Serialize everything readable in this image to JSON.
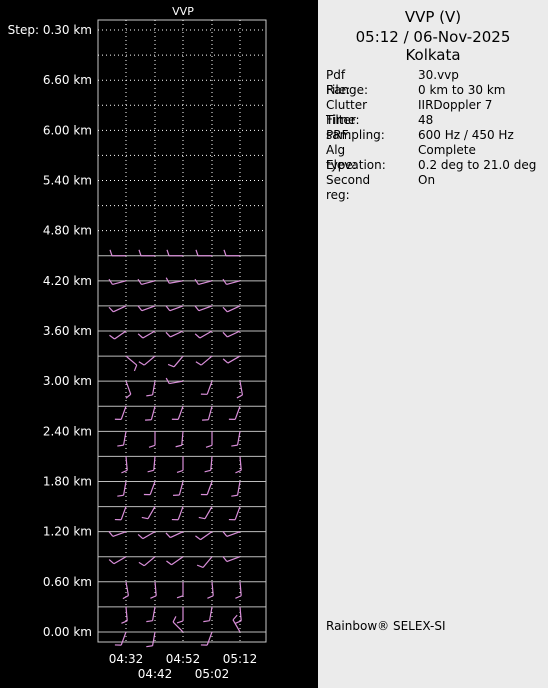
{
  "header": {
    "line1": "VVP (V)",
    "line2": "05:12 / 06-Nov-2025",
    "line3": "Kolkata"
  },
  "info": [
    {
      "label": "Pdf File:",
      "value": "30.vvp"
    },
    {
      "label": "Range:",
      "value": "0 km to 30 km"
    },
    {
      "label": "Clutter Filter:",
      "value": "IIRDoppler 7"
    },
    {
      "label": "Time sampling:",
      "value": "48"
    },
    {
      "label": "PRF:",
      "value": "600 Hz / 450 Hz"
    },
    {
      "label": "Alg type:",
      "value": "Complete"
    },
    {
      "label": "Elevation:",
      "value": "0.2 deg to 21.0 deg"
    },
    {
      "label": "Second reg:",
      "value": "On"
    }
  ],
  "vendor": "Rainbow® SELEX-SI",
  "chart_data": {
    "type": "wind-barb-profile",
    "title": "VVP",
    "y_tick_labels": [
      "Step: 0.30 km",
      "6.60 km",
      "6.00 km",
      "5.40 km",
      "4.80 km",
      "4.20 km",
      "3.60 km",
      "3.00 km",
      "2.40 km",
      "1.80 km",
      "1.20 km",
      "0.60 km",
      "0.00 km"
    ],
    "y_ticks_km": [
      7.2,
      6.6,
      6.0,
      5.4,
      4.8,
      4.2,
      3.6,
      3.0,
      2.4,
      1.8,
      1.2,
      0.6,
      0.0
    ],
    "ylim_km": [
      -0.12,
      7.32
    ],
    "height_step_km": 0.3,
    "x_tick_labels_top": [
      "04:32",
      "04:52",
      "05:12"
    ],
    "x_tick_labels_bottom": [
      "04:42",
      "05:02"
    ],
    "times": [
      "04:32",
      "04:42",
      "04:52",
      "05:02",
      "05:12"
    ],
    "heights_km": [
      0.0,
      0.3,
      0.6,
      0.9,
      1.2,
      1.5,
      1.8,
      2.1,
      2.4,
      2.7,
      3.0,
      3.3,
      3.6,
      3.9,
      4.2,
      4.5
    ],
    "barb_color": "#d98ed9",
    "grid": true,
    "barbs": [
      {
        "height_km": 0.0,
        "dir_deg": [
          200,
          190,
          315,
          200,
          330
        ]
      },
      {
        "height_km": 0.3,
        "dir_deg": [
          175,
          190,
          180,
          190,
          175
        ]
      },
      {
        "height_km": 0.6,
        "dir_deg": [
          170,
          175,
          180,
          175,
          175
        ]
      },
      {
        "height_km": 0.9,
        "dir_deg": [
          240,
          230,
          235,
          220,
          250
        ]
      },
      {
        "height_km": 1.2,
        "dir_deg": [
          250,
          240,
          245,
          235,
          250
        ]
      },
      {
        "height_km": 1.5,
        "dir_deg": [
          200,
          210,
          200,
          210,
          200
        ]
      },
      {
        "height_km": 1.8,
        "dir_deg": [
          190,
          200,
          195,
          200,
          190
        ]
      },
      {
        "height_km": 2.1,
        "dir_deg": [
          175,
          185,
          180,
          185,
          175
        ]
      },
      {
        "height_km": 2.4,
        "dir_deg": [
          190,
          180,
          185,
          180,
          190
        ]
      },
      {
        "height_km": 2.7,
        "dir_deg": [
          200,
          195,
          200,
          195,
          200
        ]
      },
      {
        "height_km": 3.0,
        "dir_deg": [
          160,
          190,
          260,
          200,
          170
        ]
      },
      {
        "height_km": 3.3,
        "dir_deg": [
          130,
          230,
          220,
          230,
          240
        ]
      },
      {
        "height_km": 3.6,
        "dir_deg": [
          235,
          240,
          245,
          240,
          245
        ]
      },
      {
        "height_km": 3.9,
        "dir_deg": [
          245,
          250,
          250,
          250,
          245
        ]
      },
      {
        "height_km": 4.2,
        "dir_deg": [
          255,
          255,
          260,
          255,
          255
        ]
      },
      {
        "height_km": 4.5,
        "dir_deg": [
          270,
          270,
          270,
          270,
          270
        ]
      }
    ]
  }
}
